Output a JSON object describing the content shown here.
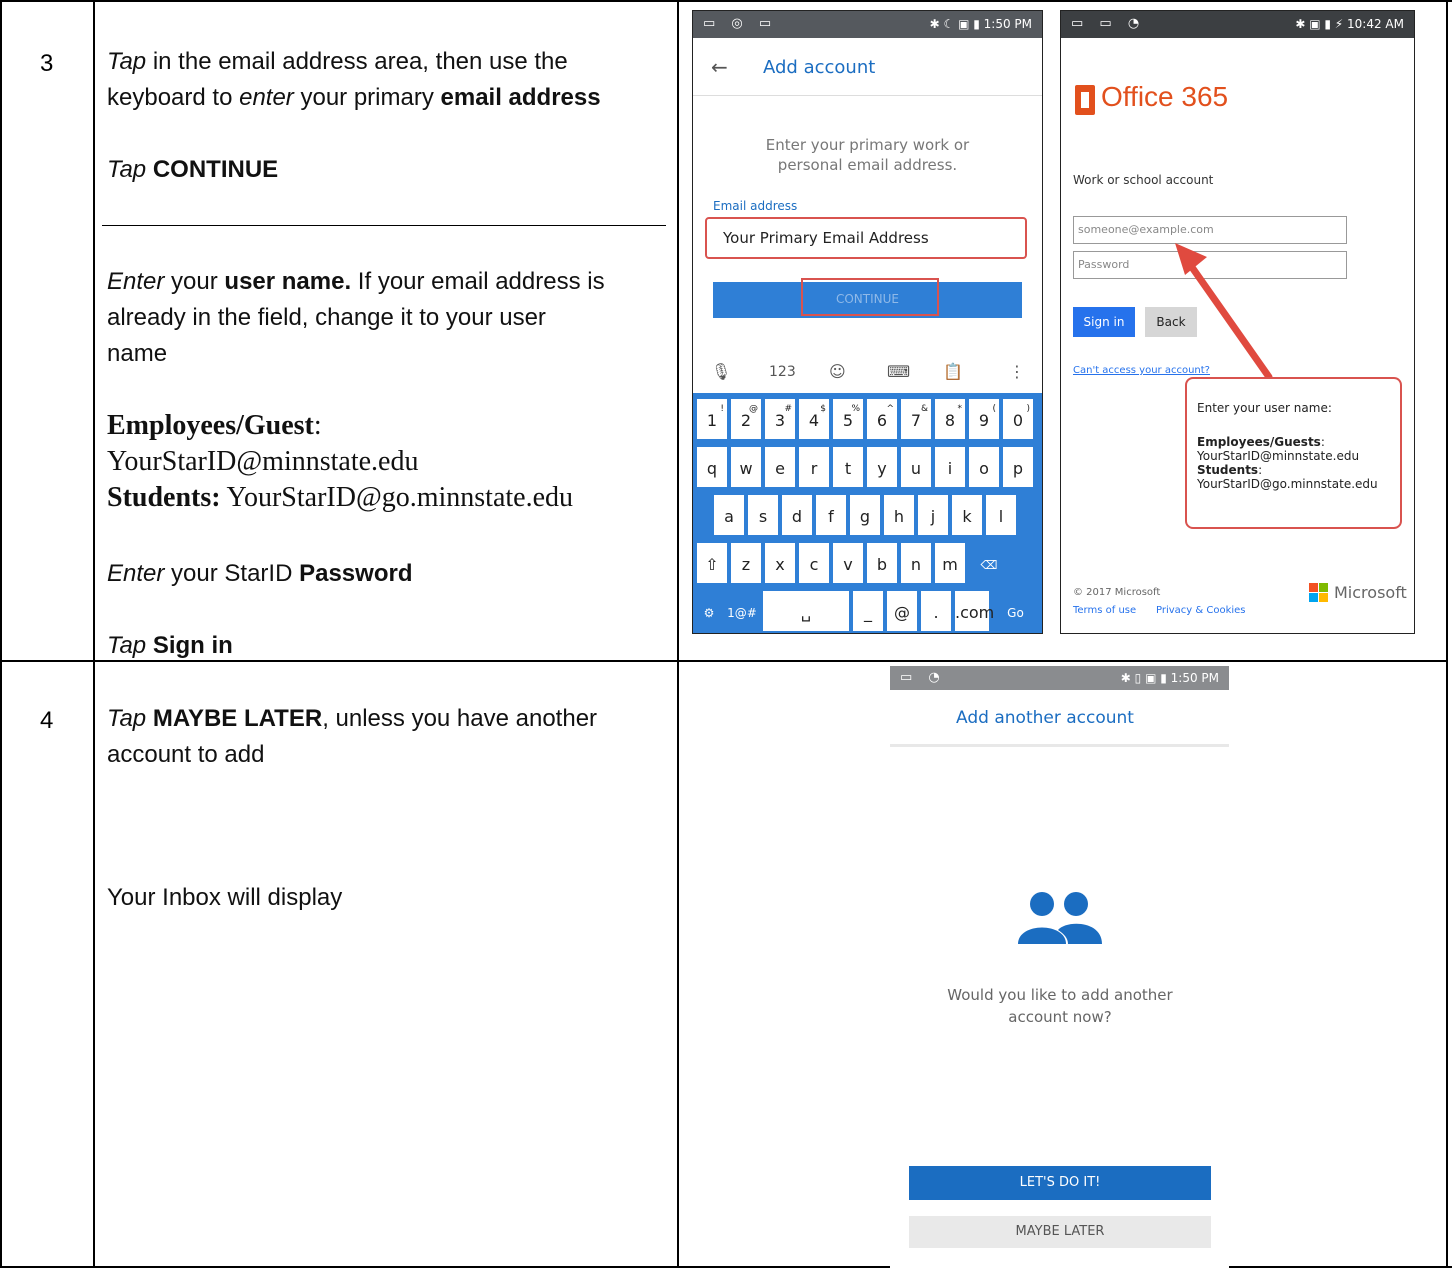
{
  "rows": [
    {
      "number": "3",
      "block1": {
        "line1_a": "Tap",
        "line1_b": " in the email address area, then use the",
        "line2_a": "keyboard to ",
        "line2_b": "enter",
        "line2_c": " your primary ",
        "line2_d": "email address",
        "tap_a": "Tap",
        "tap_b": "CONTINUE"
      },
      "block2": {
        "l1_a": "Enter",
        "l1_b": " your ",
        "l1_c": "user name.",
        "l1_d": " If your email address is",
        "l2": "already in the field, change it to your user",
        "l3": "name",
        "emp_label": "Employees/Guest",
        "emp_colon": ":",
        "emp_value": "YourStarID@minnstate.edu",
        "stu_label": "Students:",
        "stu_value": " YourStarID@go.minnstate.edu",
        "pw_a": "Enter",
        "pw_b": " your StarID ",
        "pw_c": "Password",
        "sign_a": "Tap",
        "sign_b": "Sign in"
      }
    },
    {
      "number": "4",
      "line1_a": "Tap",
      "line1_b": "MAYBE LATER",
      "line1_c": ", unless you have another",
      "line2": "account to add",
      "inbox": "Your Inbox will display"
    }
  ],
  "screen_add_account": {
    "status_time": "1:50 PM",
    "back_arrow": "←",
    "title": "Add account",
    "prompt_line1": "Enter your primary work or",
    "prompt_line2": "personal email address.",
    "field_label": "Email address",
    "field_value": "Your Primary Email Address",
    "continue_label": "CONTINUE",
    "keyboard": {
      "tools": [
        "🎙",
        "123",
        "☺",
        "⌨",
        "📋",
        "⋮"
      ],
      "row1": [
        "1",
        "2",
        "3",
        "4",
        "5",
        "6",
        "7",
        "8",
        "9",
        "0"
      ],
      "row1_sup": [
        "!",
        "@",
        "#",
        "$",
        "%",
        "^",
        "&",
        "*",
        "(",
        ")"
      ],
      "row2": [
        "q",
        "w",
        "e",
        "r",
        "t",
        "y",
        "u",
        "i",
        "o",
        "p"
      ],
      "row3": [
        "a",
        "s",
        "d",
        "f",
        "g",
        "h",
        "j",
        "k",
        "l"
      ],
      "row4": [
        "⇧",
        "z",
        "x",
        "c",
        "v",
        "b",
        "n",
        "m",
        "⌫"
      ],
      "row5": [
        "⚙",
        "1@#",
        "␣",
        "_",
        "@",
        ".",
        ".com",
        "Go"
      ]
    }
  },
  "screen_office": {
    "status_time": "10:42 AM",
    "brand": "Office 365",
    "account_label": "Work or school account",
    "email_placeholder": "someone@example.com",
    "password_placeholder": "Password",
    "signin_label": "Sign in",
    "back_label": "Back",
    "cant_access": "Can't access your account?",
    "callout_title": "Enter your user name:",
    "callout_emp_label": "Employees/Guests",
    "callout_emp_colon": ":",
    "callout_emp_value": "YourStarID@minnstate.edu",
    "callout_stu_label": "Students",
    "callout_stu_colon": ":",
    "callout_stu_value": "YourStarID@go.minnstate.edu",
    "copyright": "© 2017 Microsoft",
    "terms": "Terms of use",
    "privacy": "Privacy & Cookies",
    "ms_brand": "Microsoft",
    "arrow_color": "#e04a3f",
    "callout_border": "#d9534f"
  },
  "screen_another": {
    "status_time": "1:50 PM",
    "title": "Add another account",
    "question_line1": "Would you like to add another",
    "question_line2": "account now?",
    "lets_label": "LET'S DO IT!",
    "later_label": "MAYBE LATER",
    "accent": "#1b6dc1"
  }
}
